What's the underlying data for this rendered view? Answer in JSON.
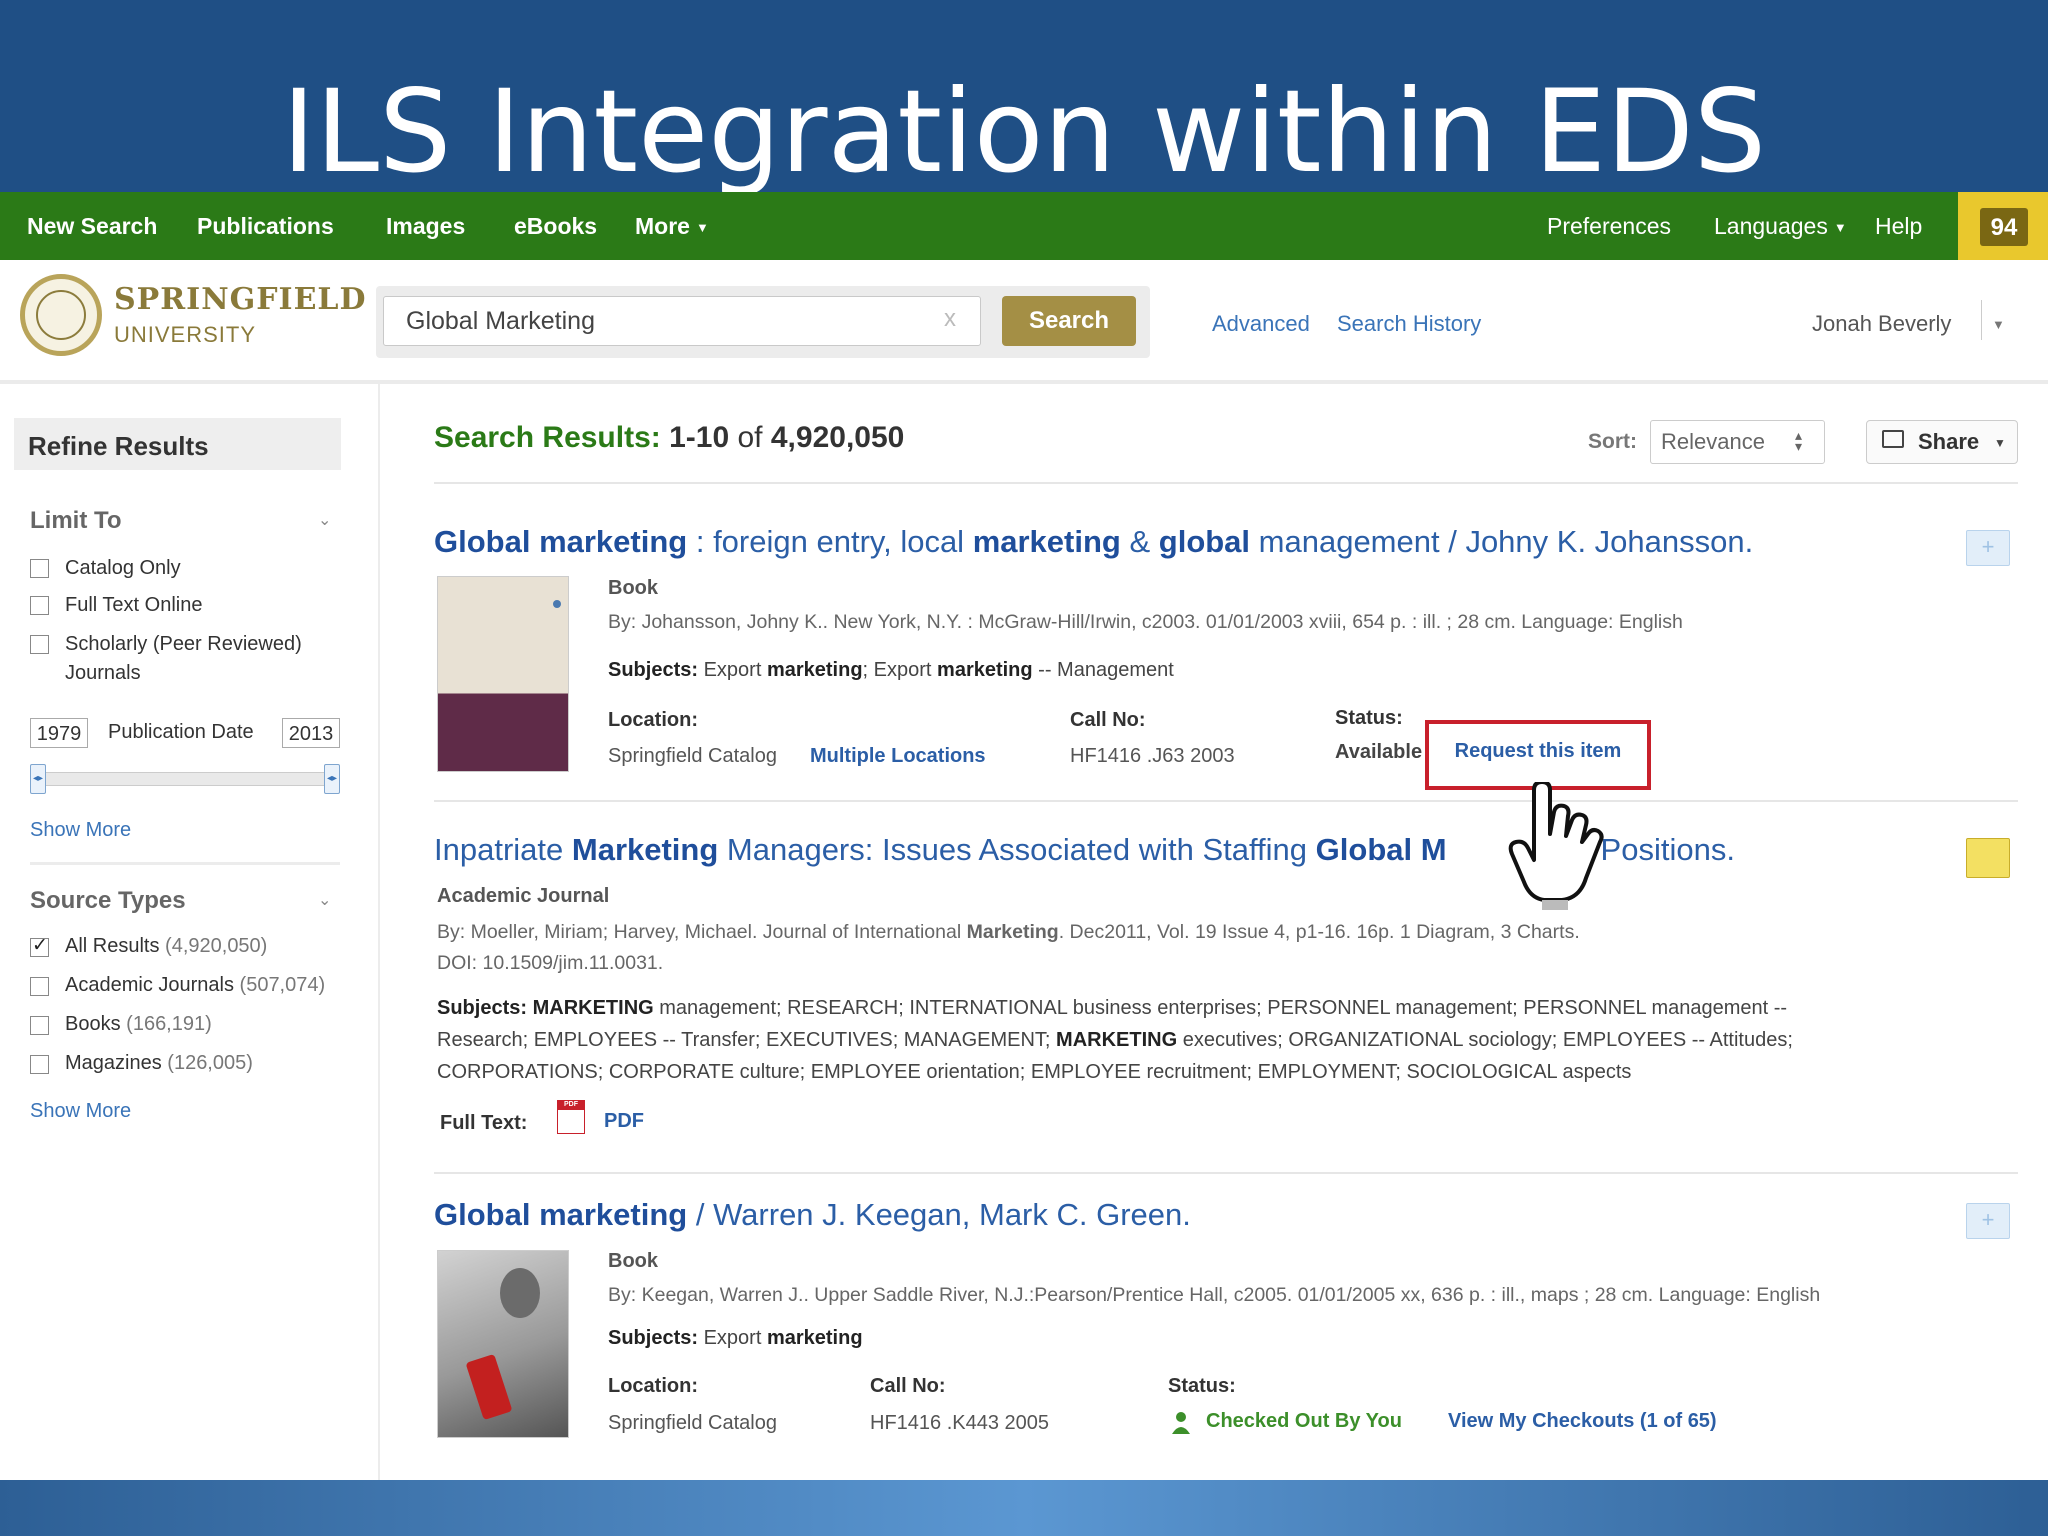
{
  "slide": {
    "title": "ILS Integration within EDS"
  },
  "topnav": {
    "left": [
      "New Search",
      "Publications",
      "Images",
      "eBooks",
      "More"
    ],
    "right": [
      "Preferences",
      "Languages",
      "Help"
    ],
    "folder_count": "94"
  },
  "header": {
    "logo_name": "SPRINGFIELD",
    "logo_sub": "UNIVERSITY",
    "search_value": "Global Marketing",
    "search_clear": "x",
    "search_button": "Search",
    "advanced": "Advanced",
    "history": "Search History",
    "user": "Jonah Beverly"
  },
  "sidebar": {
    "refine": "Refine Results",
    "limit_to": "Limit To",
    "limits": [
      "Catalog Only",
      "Full Text Online",
      "Scholarly (Peer Reviewed)",
      "Journals"
    ],
    "date_from": "1979",
    "date_label": "Publication Date",
    "date_to": "2013",
    "show_more": "Show More",
    "source_types": "Source Types",
    "sources": [
      {
        "label": "All Results",
        "count": "(4,920,050)",
        "checked": true
      },
      {
        "label": "Academic Journals",
        "count": "(507,074)",
        "checked": false
      },
      {
        "label": "Books",
        "count": "(166,191)",
        "checked": false
      },
      {
        "label": "Magazines",
        "count": "(126,005)",
        "checked": false
      }
    ]
  },
  "results": {
    "label": "Search Results:",
    "range": "1-10",
    "of": "of",
    "total": "4,920,050",
    "sort_label": "Sort:",
    "sort_value": "Relevance",
    "share": "Share",
    "items": [
      {
        "title": [
          "Global marketing",
          " : foreign entry, local ",
          "marketing",
          " & ",
          "global",
          " management / Johny K. Johansson."
        ],
        "type": "Book",
        "meta": "By: Johansson, Johny K.. New York, N.Y. : McGraw-Hill/Irwin, c2003. 01/01/2003 xviii, 654 p. : ill. ; 28 cm. Language: English",
        "subjects_label": "Subjects:",
        "subjects": [
          "Export ",
          "marketing",
          "; Export ",
          "marketing",
          " -- Management"
        ],
        "location_label": "Location:",
        "location": "Springfield Catalog",
        "location_link": "Multiple Locations",
        "callno_label": "Call No:",
        "callno": "HF1416 .J63 2003",
        "status_label": "Status:",
        "status": "Available",
        "request": "Request this item"
      },
      {
        "title": [
          "Inpatriate ",
          "Marketing",
          " Managers: Issues Associated with Staffing ",
          "Global",
          " M",
          "ing Positions."
        ],
        "type": "Academic Journal",
        "meta1": [
          "By: Moeller, Miriam; Harvey, Michael. Journal of International ",
          "Marketing",
          ". Dec2011, Vol. 19 Issue 4, p1-16. 16p. 1 Diagram, 3 Charts."
        ],
        "meta2": "DOI: 10.1509/jim.11.0031.",
        "subjects_label": "Subjects:",
        "subj_line1": [
          "MARKETING",
          " management; RESEARCH; INTERNATIONAL business enterprises; PERSONNEL management; PERSONNEL management --"
        ],
        "subj_line2": [
          "Research; EMPLOYEES -- Transfer; EXECUTIVES; MANAGEMENT; ",
          "MARKETING",
          " executives; ORGANIZATIONAL sociology; EMPLOYEES -- Attitudes;"
        ],
        "subj_line3": "CORPORATIONS; CORPORATE culture; EMPLOYEE orientation; EMPLOYEE recruitment; EMPLOYMENT; SOCIOLOGICAL aspects",
        "fulltext_label": "Full Text:",
        "pdf_icon_text": "PDF",
        "pdf": "PDF"
      },
      {
        "title": [
          "Global marketing",
          " / Warren J. Keegan, Mark C. Green."
        ],
        "type": "Book",
        "meta": "By: Keegan, Warren J.. Upper Saddle River, N.J.:Pearson/Prentice Hall, c2005. 01/01/2005 xx, 636 p. : ill., maps ; 28 cm. Language: English",
        "subjects_label": "Subjects:",
        "subjects": [
          "Export ",
          "marketing"
        ],
        "location_label": "Location:",
        "location": "Springfield Catalog",
        "callno_label": "Call No:",
        "callno": "HF1416 .K443 2005",
        "status_label": "Status:",
        "status": "Checked Out By You",
        "checkouts": "View My Checkouts (1 of 65)"
      }
    ]
  },
  "icons": [
    "folder-icon",
    "seal-icon",
    "share-icon",
    "pdf-icon",
    "person-icon",
    "hand-cursor-icon",
    "add-to-folder-icon"
  ],
  "colors": {
    "slide": "#1f4f85",
    "nav": "#2b7a17",
    "search_button": "#a48f45",
    "link": "#2b5ea6",
    "request_border": "#c8202b",
    "folder": "#e9c82d"
  }
}
